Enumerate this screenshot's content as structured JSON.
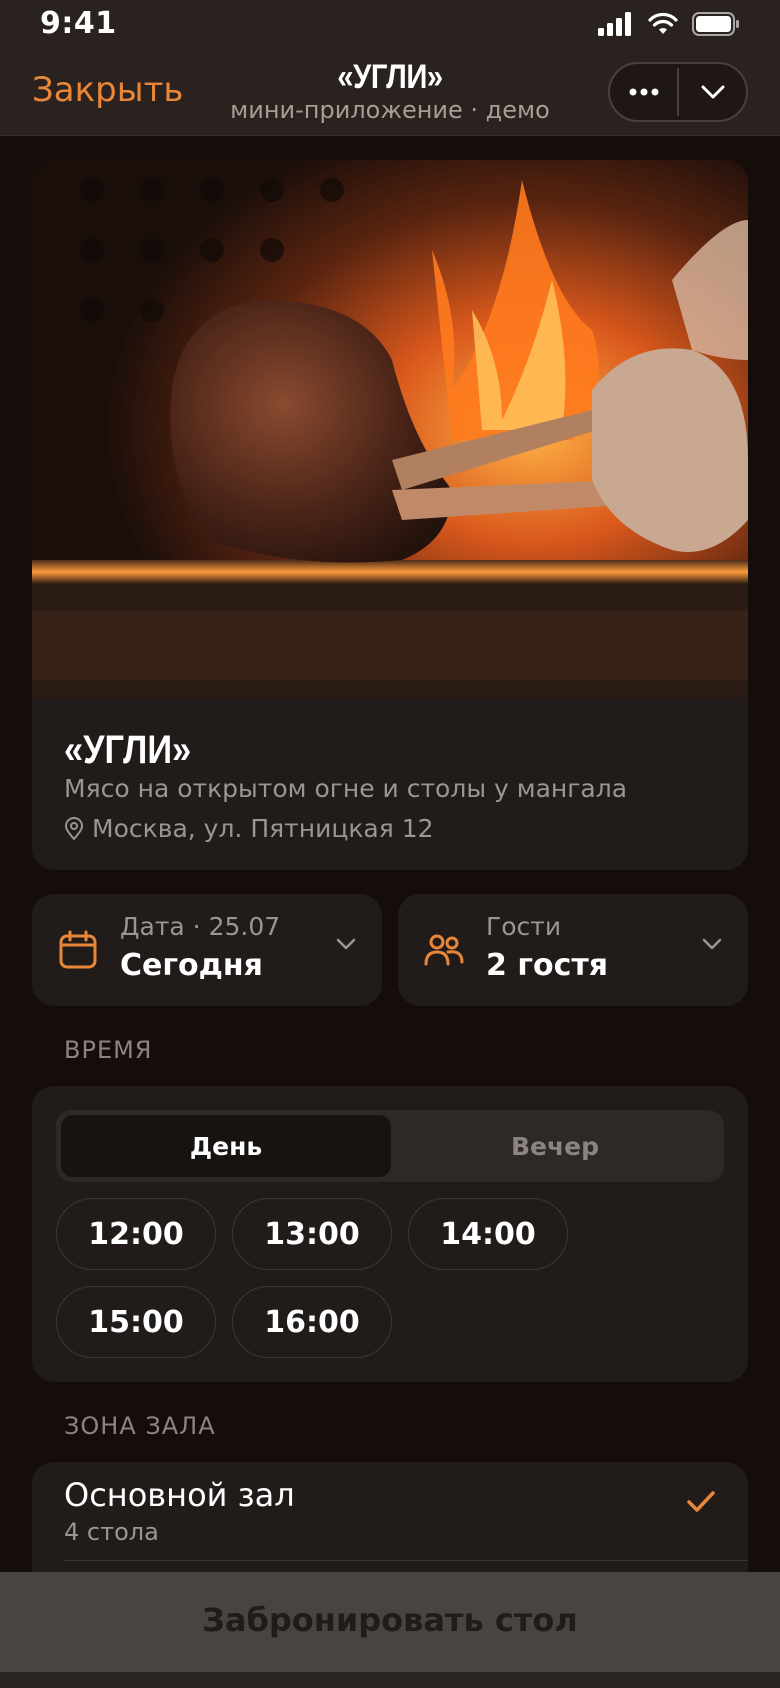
{
  "status_bar": {
    "time": "9:41"
  },
  "nav": {
    "close_label": "Закрыть",
    "title": "«УГЛИ»",
    "subtitle": "мини-приложение · демо"
  },
  "venue": {
    "name": "«УГЛИ»",
    "description": "Мясо на открытом огне и столы у мангала",
    "address": "Москва, ул. Пятницкая 12"
  },
  "date_picker": {
    "label": "Дата · 25.07",
    "value": "Сегодня"
  },
  "guests_picker": {
    "label": "Гости",
    "value": "2 гостя"
  },
  "time_section": {
    "label": "ВРЕМЯ",
    "tabs": [
      {
        "label": "День",
        "active": true
      },
      {
        "label": "Вечер",
        "active": false
      }
    ],
    "slots": [
      "12:00",
      "13:00",
      "14:00",
      "15:00",
      "16:00"
    ]
  },
  "zone_section": {
    "label": "ЗОНА ЗАЛА",
    "zones": [
      {
        "name": "Основной зал",
        "tables": "4 стола",
        "selected": true
      }
    ]
  },
  "book_button": {
    "label": "Забронировать стол"
  },
  "colors": {
    "accent": "#e8873a",
    "background": "#140d0a",
    "card": "#211c1a",
    "nav": "#2a221e",
    "disabled_button": "#4a4441"
  }
}
